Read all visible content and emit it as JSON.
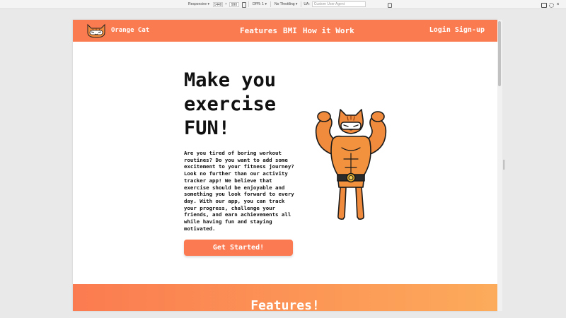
{
  "devtools": {
    "device": "Responsive ▾",
    "width": "1440",
    "height": "990",
    "dpr": "DPR: 1 ▾",
    "throttle": "No Throttling ▾",
    "ua_label": "UA:",
    "ua_placeholder": "Custom User Agent"
  },
  "nav": {
    "brand": "Orange Cat",
    "links": [
      "Features",
      "BMI",
      "How it Work"
    ],
    "login": "Login",
    "signup": "Sign-up"
  },
  "hero": {
    "title_line1": "Make you",
    "title_line2": "exercise",
    "title_line3": "FUN!",
    "body": "Are you tired of boring workout routines? Do you want to add some excitement to your fitness journey? Look no further than our activity tracker app! We believe that exercise should be enjoyable and something you look forward to every day. With our app, you can track your progress, challenge your friends, and earn achievements all while having fun and staying motivated.",
    "cta": "Get Started!"
  },
  "features": {
    "heading": "Features!"
  },
  "colors": {
    "nav": "#fb7b50",
    "cta": "#fb7a51",
    "band_start": "#fb7b50",
    "band_end": "#fcab5b"
  },
  "icons": {
    "logo": "orange-cat-logo-icon",
    "mascot": "muscular-cat-mascot"
  }
}
